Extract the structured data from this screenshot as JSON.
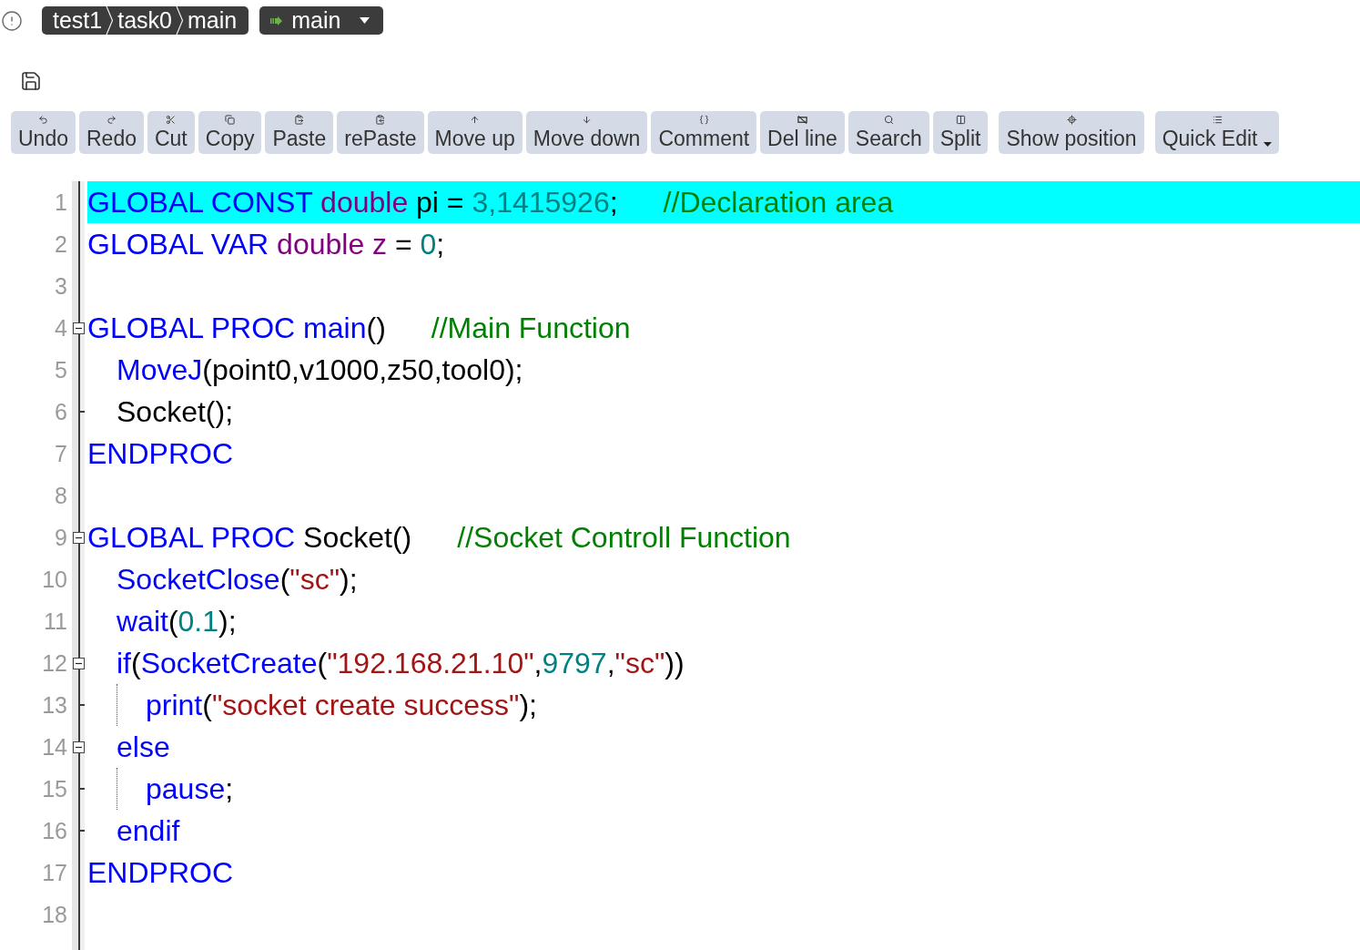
{
  "breadcrumb": [
    "test1",
    "task0",
    "main"
  ],
  "routine_selector": {
    "value": "main"
  },
  "toolbar": {
    "groups": [
      {
        "buttons": [
          {
            "label": "Undo",
            "kind": "action"
          },
          {
            "label": "Redo",
            "kind": "action"
          },
          {
            "label": "Cut",
            "kind": "action"
          },
          {
            "label": "Copy",
            "kind": "action"
          },
          {
            "label": "Paste",
            "kind": "action"
          },
          {
            "label": "rePaste",
            "kind": "action"
          },
          {
            "label": "Move up",
            "kind": "action"
          },
          {
            "label": "Move down",
            "kind": "action"
          },
          {
            "label": "Comment",
            "kind": "action"
          },
          {
            "label": "Del line",
            "kind": "action"
          },
          {
            "label": "Search",
            "kind": "action"
          },
          {
            "label": "Split",
            "kind": "action"
          }
        ]
      },
      {
        "buttons": [
          {
            "label": "Show position",
            "kind": "action"
          }
        ]
      },
      {
        "buttons": [
          {
            "label": "Quick Edit",
            "kind": "menu"
          }
        ]
      }
    ]
  },
  "editor": {
    "lines": [
      {
        "number": "1",
        "selected": true,
        "tokens": [
          {
            "kind": "keyword",
            "text": "GLOBAL CONST "
          },
          {
            "kind": "type",
            "text": "double "
          },
          {
            "kind": "plain",
            "text": "pi = "
          },
          {
            "kind": "number",
            "text": "3,1415926"
          },
          {
            "kind": "plain",
            "text": ";"
          }
        ],
        "comment": "//Declaration area"
      },
      {
        "number": "2",
        "selected": false,
        "tokens": [
          {
            "kind": "keyword",
            "text": "GLOBAL VAR "
          },
          {
            "kind": "type",
            "text": "double z"
          },
          {
            "kind": "plain",
            "text": " = "
          },
          {
            "kind": "number",
            "text": "0"
          },
          {
            "kind": "plain",
            "text": ";"
          }
        ]
      },
      {
        "number": "3",
        "selected": false
      },
      {
        "number": "4",
        "selected": false,
        "tokens": [
          {
            "kind": "keyword",
            "text": "GLOBAL PROC main"
          },
          {
            "kind": "plain",
            "text": "()"
          }
        ],
        "comment": "//Main Function",
        "expanded": true,
        "children": [
          {
            "number": "5",
            "selected": false,
            "tokens": [
              {
                "kind": "keyword",
                "text": "MoveJ"
              },
              {
                "kind": "plain",
                "text": "(point0,v1000,z50,tool0);"
              }
            ]
          },
          {
            "number": "6",
            "selected": false,
            "tokens": [
              {
                "kind": "plain",
                "text": "Socket();"
              }
            ]
          }
        ]
      },
      {
        "number": "7",
        "selected": false,
        "tokens": [
          {
            "kind": "keyword",
            "text": "ENDPROC"
          }
        ]
      },
      {
        "number": "8",
        "selected": false
      },
      {
        "number": "9",
        "selected": false,
        "tokens": [
          {
            "kind": "keyword",
            "text": "GLOBAL PROC "
          },
          {
            "kind": "plain",
            "text": "Socket()"
          }
        ],
        "comment": "//Socket Controll Function",
        "expanded": true,
        "children": [
          {
            "number": "10",
            "selected": false,
            "tokens": [
              {
                "kind": "keyword",
                "text": "SocketClose"
              },
              {
                "kind": "plain",
                "text": "("
              },
              {
                "kind": "string",
                "text": "\"sc\""
              },
              {
                "kind": "plain",
                "text": ");"
              }
            ]
          },
          {
            "number": "11",
            "selected": false,
            "tokens": [
              {
                "kind": "keyword",
                "text": "wait"
              },
              {
                "kind": "plain",
                "text": "("
              },
              {
                "kind": "number",
                "text": "0.1"
              },
              {
                "kind": "plain",
                "text": ");"
              }
            ]
          },
          {
            "number": "12",
            "selected": false,
            "tokens": [
              {
                "kind": "keyword",
                "text": "if"
              },
              {
                "kind": "plain",
                "text": "("
              },
              {
                "kind": "keyword",
                "text": "SocketCreate"
              },
              {
                "kind": "plain",
                "text": "("
              },
              {
                "kind": "string",
                "text": "\"192.168.21.10\""
              },
              {
                "kind": "plain",
                "text": ","
              },
              {
                "kind": "number",
                "text": "9797"
              },
              {
                "kind": "plain",
                "text": ","
              },
              {
                "kind": "string",
                "text": "\"sc\""
              },
              {
                "kind": "plain",
                "text": "))"
              }
            ],
            "expanded": true,
            "children": [
              {
                "number": "13",
                "selected": false,
                "tokens": [
                  {
                    "kind": "keyword",
                    "text": "print"
                  },
                  {
                    "kind": "plain",
                    "text": "("
                  },
                  {
                    "kind": "string",
                    "text": "\"socket create success\""
                  },
                  {
                    "kind": "plain",
                    "text": ");"
                  }
                ]
              }
            ]
          },
          {
            "number": "14",
            "selected": false,
            "tokens": [
              {
                "kind": "keyword",
                "text": "else"
              }
            ],
            "expanded": true,
            "children": [
              {
                "number": "15",
                "selected": false,
                "tokens": [
                  {
                    "kind": "keyword",
                    "text": "pause"
                  },
                  {
                    "kind": "plain",
                    "text": ";"
                  }
                ]
              }
            ]
          },
          {
            "number": "16",
            "selected": false,
            "tokens": [
              {
                "kind": "keyword",
                "text": "endif"
              }
            ]
          }
        ]
      },
      {
        "number": "17",
        "selected": false,
        "tokens": [
          {
            "kind": "keyword",
            "text": "ENDPROC"
          }
        ]
      },
      {
        "number": "18",
        "selected": false
      }
    ]
  }
}
